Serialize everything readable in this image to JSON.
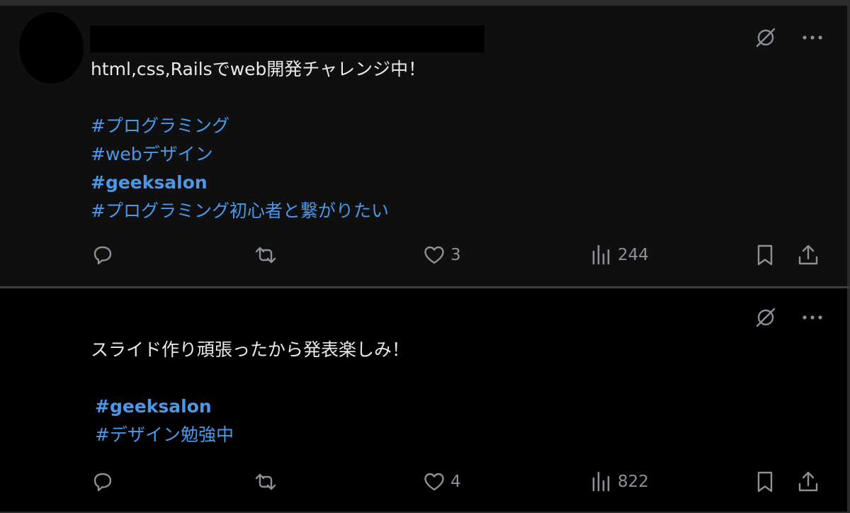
{
  "posts": [
    {
      "text": "html,css,Railsでweb開発チャレンジ中！",
      "hashtags": [
        {
          "label": "#プログラミング"
        },
        {
          "label": "#webデザイン"
        },
        {
          "label": "#geeksalon"
        },
        {
          "label": "#プログラミング初心者と繋がりたい"
        }
      ],
      "likes": "3",
      "views": "244"
    },
    {
      "text": "スライド作り頑張ったから発表楽しみ！",
      "hashtags": [
        {
          "label": "#geeksalon"
        },
        {
          "label": "#デザイン勉強中"
        }
      ],
      "likes": "4",
      "views": "822"
    }
  ],
  "colors": {
    "hashtag": "#4b97e8",
    "muted": "#8b9196",
    "text": "#e7e9ea"
  },
  "icons": [
    "grok-icon",
    "more-icon",
    "reply-icon",
    "retweet-icon",
    "like-icon",
    "views-icon",
    "bookmark-icon",
    "share-icon"
  ]
}
